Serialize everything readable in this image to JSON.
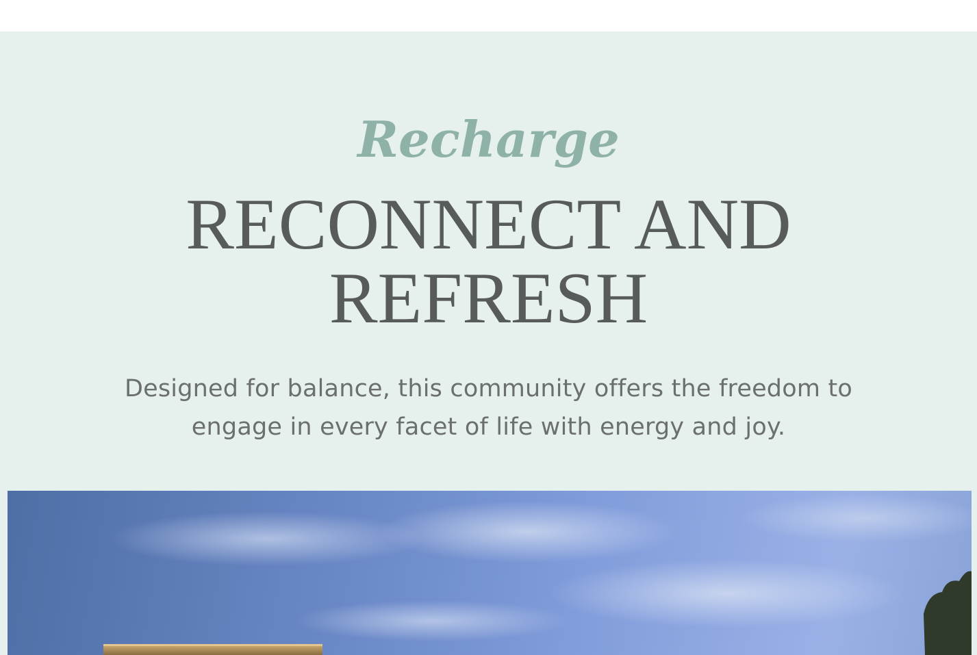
{
  "section": {
    "script_title": "Recharge",
    "main_title": "RECONNECT AND REFRESH",
    "description": "Designed for balance, this community offers the freedom to engage in every facet of life with energy and joy."
  },
  "colors": {
    "section_background": "#e6f0ed",
    "script_title": "#8fb2a8",
    "main_title": "#575b59",
    "description": "#6b6f6d"
  },
  "hero_image": {
    "subject": "building-at-dusk-photo"
  }
}
